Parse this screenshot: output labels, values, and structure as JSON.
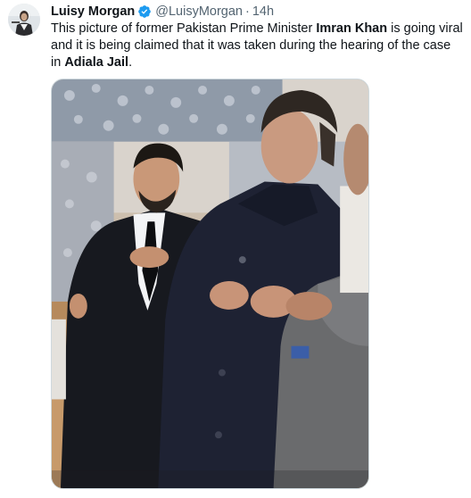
{
  "tweet": {
    "display_name": "Luisy Morgan",
    "handle": "@LuisyMorgan",
    "separator": "·",
    "time": "14h",
    "text": {
      "part1": "This picture of former Pakistan Prime Minister ",
      "bold1": "Imran Khan",
      "part2": " is going viral and it is being claimed that it was taken during the hearing of the case in ",
      "bold2": "Adiala Jail",
      "part3": "."
    }
  },
  "icons": {
    "verified": "verified-badge-icon"
  },
  "colors": {
    "verified_blue": "#1d9bf0",
    "text_primary": "#0f1419",
    "text_secondary": "#536471",
    "media_border": "#cfd9de"
  }
}
